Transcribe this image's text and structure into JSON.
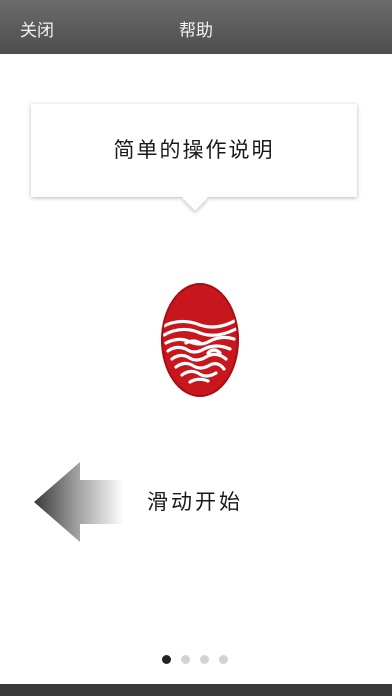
{
  "navbar": {
    "close_label": "关闭",
    "title": "帮助"
  },
  "tip": {
    "text": "简单的操作说明"
  },
  "swipe": {
    "label": "滑动开始"
  },
  "pager": {
    "total_pages": 4,
    "current_page": 1
  },
  "colors": {
    "navbar": "#5a5a5a",
    "seal_red": "#c8161d",
    "dot_active": "#222222",
    "dot_inactive": "#d3d3d3"
  },
  "icons": {
    "fingerprint": "fingerprint-seal-icon",
    "swipe": "arrow-left-icon"
  }
}
